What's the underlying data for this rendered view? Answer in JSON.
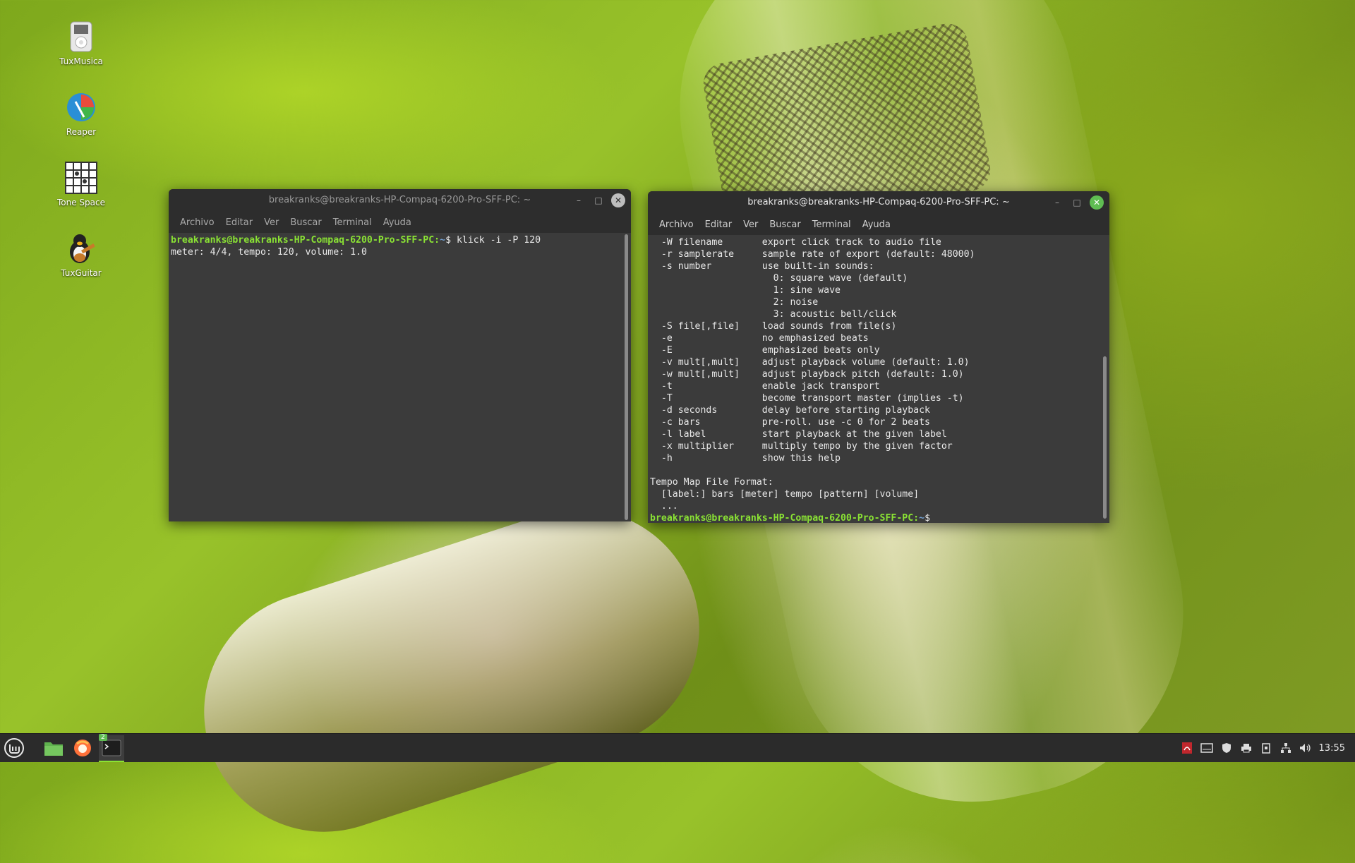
{
  "desktop": {
    "icons": [
      {
        "label": "TuxMusica",
        "icon": "ipod-icon"
      },
      {
        "label": "Reaper",
        "icon": "reaper-icon"
      },
      {
        "label": "Tone Space",
        "icon": "grid-icon"
      },
      {
        "label": "TuxGuitar",
        "icon": "tux-guitar-icon"
      }
    ]
  },
  "window_left": {
    "title": "breakranks@breakranks-HP-Compaq-6200-Pro-SFF-PC: ~",
    "menu": [
      "Archivo",
      "Editar",
      "Ver",
      "Buscar",
      "Terminal",
      "Ayuda"
    ],
    "prompt_user": "breakranks@breakranks-HP-Compaq-6200-Pro-SFF-PC",
    "prompt_sep": ":",
    "prompt_path": "~",
    "prompt_end": "$ ",
    "command": "klick -i -P 120",
    "output": "meter: 4/4, tempo: 120, volume: 1.0"
  },
  "window_right": {
    "title": "breakranks@breakranks-HP-Compaq-6200-Pro-SFF-PC: ~",
    "menu": [
      "Archivo",
      "Editar",
      "Ver",
      "Buscar",
      "Terminal",
      "Ayuda"
    ],
    "lines": [
      "  -W filename       export click track to audio file",
      "  -r samplerate     sample rate of export (default: 48000)",
      "  -s number         use built-in sounds:",
      "                      0: square wave (default)",
      "                      1: sine wave",
      "                      2: noise",
      "                      3: acoustic bell/click",
      "  -S file[,file]    load sounds from file(s)",
      "  -e                no emphasized beats",
      "  -E                emphasized beats only",
      "  -v mult[,mult]    adjust playback volume (default: 1.0)",
      "  -w mult[,mult]    adjust playback pitch (default: 1.0)",
      "  -t                enable jack transport",
      "  -T                become transport master (implies -t)",
      "  -d seconds        delay before starting playback",
      "  -c bars           pre-roll. use -c 0 for 2 beats",
      "  -l label          start playback at the given label",
      "  -x multiplier     multiply tempo by the given factor",
      "  -h                show this help",
      "",
      "Tempo Map File Format:",
      "  [label:] bars [meter] tempo [pattern] [volume]",
      "  ..."
    ],
    "prompt_user": "breakranks@breakranks-HP-Compaq-6200-Pro-SFF-PC",
    "prompt_sep": ":",
    "prompt_path": "~",
    "prompt_end": "$"
  },
  "taskbar": {
    "menu_icon": "mint-logo-icon",
    "apps": [
      {
        "name": "files",
        "icon": "folder-icon"
      },
      {
        "name": "firefox",
        "icon": "firefox-icon"
      },
      {
        "name": "terminal",
        "icon": "terminal-icon",
        "badge": "2"
      }
    ],
    "tray": [
      "pdf-icon",
      "disk-icon",
      "shield-icon",
      "printer-icon",
      "clipboard-icon",
      "network-icon",
      "volume-icon"
    ],
    "clock": "13:55"
  }
}
